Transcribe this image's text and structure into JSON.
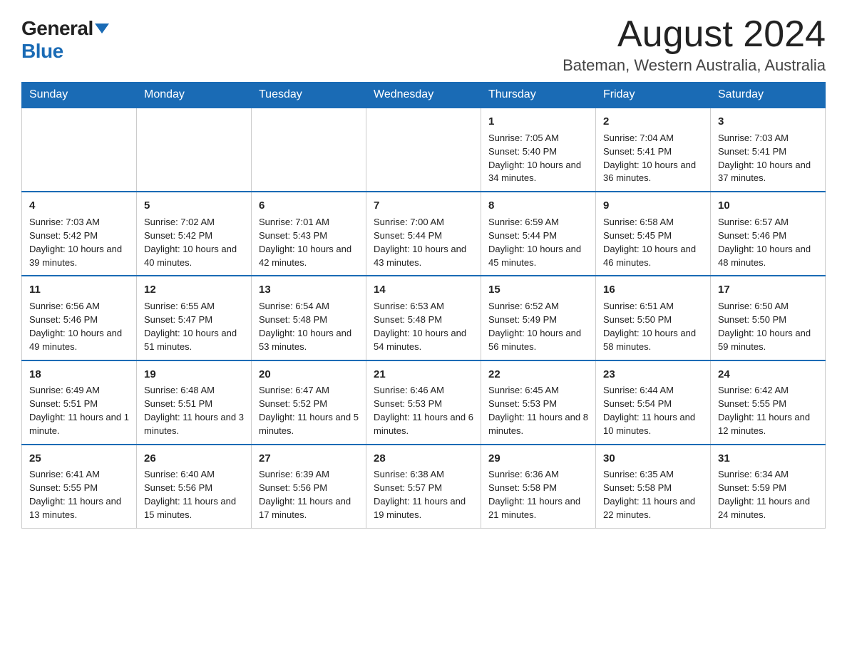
{
  "header": {
    "logo_general": "General",
    "logo_blue": "Blue",
    "month_title": "August 2024",
    "location": "Bateman, Western Australia, Australia"
  },
  "days_of_week": [
    "Sunday",
    "Monday",
    "Tuesday",
    "Wednesday",
    "Thursday",
    "Friday",
    "Saturday"
  ],
  "weeks": [
    [
      {
        "day": "",
        "info": ""
      },
      {
        "day": "",
        "info": ""
      },
      {
        "day": "",
        "info": ""
      },
      {
        "day": "",
        "info": ""
      },
      {
        "day": "1",
        "info": "Sunrise: 7:05 AM\nSunset: 5:40 PM\nDaylight: 10 hours and 34 minutes."
      },
      {
        "day": "2",
        "info": "Sunrise: 7:04 AM\nSunset: 5:41 PM\nDaylight: 10 hours and 36 minutes."
      },
      {
        "day": "3",
        "info": "Sunrise: 7:03 AM\nSunset: 5:41 PM\nDaylight: 10 hours and 37 minutes."
      }
    ],
    [
      {
        "day": "4",
        "info": "Sunrise: 7:03 AM\nSunset: 5:42 PM\nDaylight: 10 hours and 39 minutes."
      },
      {
        "day": "5",
        "info": "Sunrise: 7:02 AM\nSunset: 5:42 PM\nDaylight: 10 hours and 40 minutes."
      },
      {
        "day": "6",
        "info": "Sunrise: 7:01 AM\nSunset: 5:43 PM\nDaylight: 10 hours and 42 minutes."
      },
      {
        "day": "7",
        "info": "Sunrise: 7:00 AM\nSunset: 5:44 PM\nDaylight: 10 hours and 43 minutes."
      },
      {
        "day": "8",
        "info": "Sunrise: 6:59 AM\nSunset: 5:44 PM\nDaylight: 10 hours and 45 minutes."
      },
      {
        "day": "9",
        "info": "Sunrise: 6:58 AM\nSunset: 5:45 PM\nDaylight: 10 hours and 46 minutes."
      },
      {
        "day": "10",
        "info": "Sunrise: 6:57 AM\nSunset: 5:46 PM\nDaylight: 10 hours and 48 minutes."
      }
    ],
    [
      {
        "day": "11",
        "info": "Sunrise: 6:56 AM\nSunset: 5:46 PM\nDaylight: 10 hours and 49 minutes."
      },
      {
        "day": "12",
        "info": "Sunrise: 6:55 AM\nSunset: 5:47 PM\nDaylight: 10 hours and 51 minutes."
      },
      {
        "day": "13",
        "info": "Sunrise: 6:54 AM\nSunset: 5:48 PM\nDaylight: 10 hours and 53 minutes."
      },
      {
        "day": "14",
        "info": "Sunrise: 6:53 AM\nSunset: 5:48 PM\nDaylight: 10 hours and 54 minutes."
      },
      {
        "day": "15",
        "info": "Sunrise: 6:52 AM\nSunset: 5:49 PM\nDaylight: 10 hours and 56 minutes."
      },
      {
        "day": "16",
        "info": "Sunrise: 6:51 AM\nSunset: 5:50 PM\nDaylight: 10 hours and 58 minutes."
      },
      {
        "day": "17",
        "info": "Sunrise: 6:50 AM\nSunset: 5:50 PM\nDaylight: 10 hours and 59 minutes."
      }
    ],
    [
      {
        "day": "18",
        "info": "Sunrise: 6:49 AM\nSunset: 5:51 PM\nDaylight: 11 hours and 1 minute."
      },
      {
        "day": "19",
        "info": "Sunrise: 6:48 AM\nSunset: 5:51 PM\nDaylight: 11 hours and 3 minutes."
      },
      {
        "day": "20",
        "info": "Sunrise: 6:47 AM\nSunset: 5:52 PM\nDaylight: 11 hours and 5 minutes."
      },
      {
        "day": "21",
        "info": "Sunrise: 6:46 AM\nSunset: 5:53 PM\nDaylight: 11 hours and 6 minutes."
      },
      {
        "day": "22",
        "info": "Sunrise: 6:45 AM\nSunset: 5:53 PM\nDaylight: 11 hours and 8 minutes."
      },
      {
        "day": "23",
        "info": "Sunrise: 6:44 AM\nSunset: 5:54 PM\nDaylight: 11 hours and 10 minutes."
      },
      {
        "day": "24",
        "info": "Sunrise: 6:42 AM\nSunset: 5:55 PM\nDaylight: 11 hours and 12 minutes."
      }
    ],
    [
      {
        "day": "25",
        "info": "Sunrise: 6:41 AM\nSunset: 5:55 PM\nDaylight: 11 hours and 13 minutes."
      },
      {
        "day": "26",
        "info": "Sunrise: 6:40 AM\nSunset: 5:56 PM\nDaylight: 11 hours and 15 minutes."
      },
      {
        "day": "27",
        "info": "Sunrise: 6:39 AM\nSunset: 5:56 PM\nDaylight: 11 hours and 17 minutes."
      },
      {
        "day": "28",
        "info": "Sunrise: 6:38 AM\nSunset: 5:57 PM\nDaylight: 11 hours and 19 minutes."
      },
      {
        "day": "29",
        "info": "Sunrise: 6:36 AM\nSunset: 5:58 PM\nDaylight: 11 hours and 21 minutes."
      },
      {
        "day": "30",
        "info": "Sunrise: 6:35 AM\nSunset: 5:58 PM\nDaylight: 11 hours and 22 minutes."
      },
      {
        "day": "31",
        "info": "Sunrise: 6:34 AM\nSunset: 5:59 PM\nDaylight: 11 hours and 24 minutes."
      }
    ]
  ]
}
